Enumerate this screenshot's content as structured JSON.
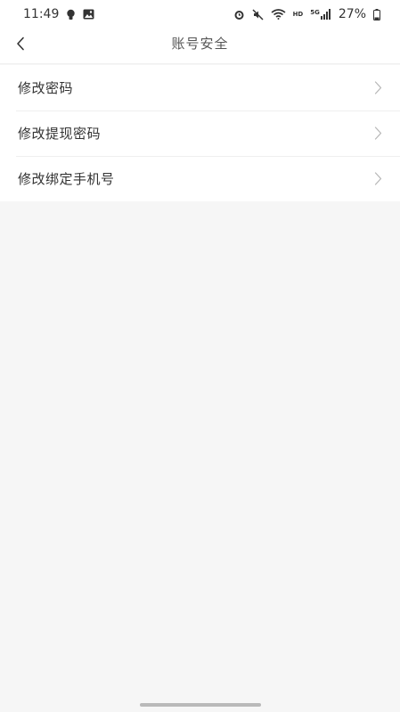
{
  "status_bar": {
    "time": "11:49",
    "battery": "27%",
    "network": "5G",
    "hd": "HD",
    "left_icons": [
      "lightbulb-icon",
      "image-icon"
    ],
    "right_icons": [
      "alarm-icon",
      "mute-icon",
      "wifi-icon",
      "signal-icon",
      "battery-icon"
    ]
  },
  "nav": {
    "title": "账号安全",
    "back_icon": "chevron-left-icon"
  },
  "menu": {
    "items": [
      {
        "label": "修改密码",
        "icon": "chevron-right-icon"
      },
      {
        "label": "修改提现密码",
        "icon": "chevron-right-icon"
      },
      {
        "label": "修改绑定手机号",
        "icon": "chevron-right-icon"
      }
    ]
  },
  "colors": {
    "page_background": "#f6f6f6",
    "surface": "#ffffff",
    "text_primary": "#333333",
    "title": "#555555",
    "chevron": "#b5b5b5"
  }
}
